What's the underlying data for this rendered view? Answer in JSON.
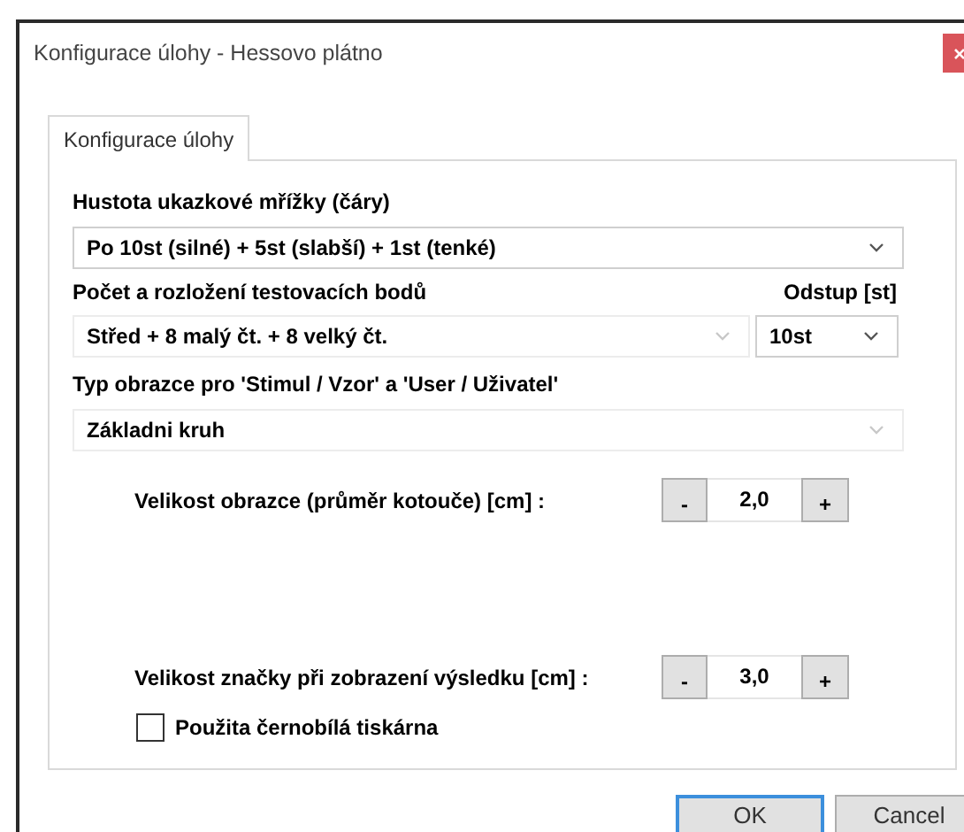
{
  "window": {
    "title": "Konfigurace úlohy - Hessovo plátno"
  },
  "tabs": [
    {
      "label": "Konfigurace úlohy",
      "selected": true
    }
  ],
  "grid_density": {
    "label": "Hustota ukazkové mřížky (čáry)",
    "value": "Po 10st (silné) + 5st (slabší) + 1st (tenké)"
  },
  "test_points": {
    "label": "Počet a rozložení testovacích bodů",
    "value": "Střed + 8 malý čt. + 8 velký čt."
  },
  "spacing": {
    "label": "Odstup [st]",
    "value": "10st"
  },
  "pattern_type": {
    "label": "Typ obrazce pro 'Stimul / Vzor' a 'User / Uživatel'",
    "value": "Základni kruh"
  },
  "pattern_size": {
    "label": "Velikost obrazce (průměr kotouče) [cm] :",
    "decrement": "-",
    "value": "2,0",
    "increment": "+"
  },
  "marker_size": {
    "label": "Velikost značky při zobrazení výsledku [cm] :",
    "decrement": "-",
    "value": "3,0",
    "increment": "+"
  },
  "bw_printer": {
    "label": "Použita černobílá tiskárna",
    "checked": false
  },
  "buttons": [
    {
      "label": "OK",
      "default": true
    },
    {
      "label": "Cancel",
      "default": false
    }
  ]
}
